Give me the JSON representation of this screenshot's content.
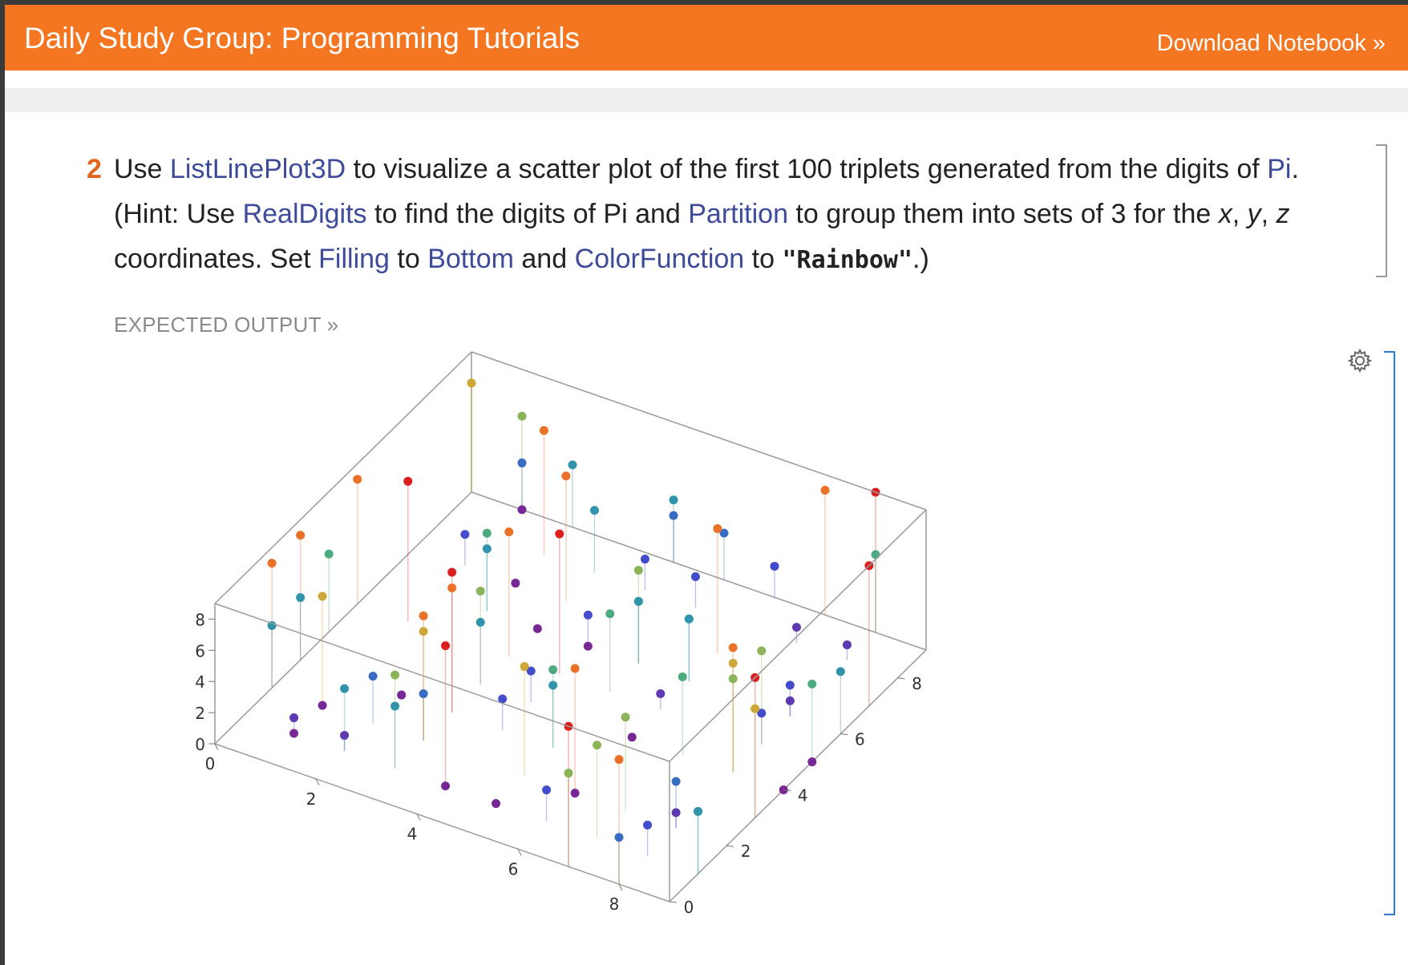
{
  "header": {
    "title": "Daily Study Group: Programming Tutorials",
    "download_label": "Download Notebook »"
  },
  "exercise": {
    "number": "2",
    "parts": {
      "p1": "Use ",
      "f1": "ListLinePlot3D",
      "p2": " to visualize a scatter plot of the first 100 triplets generated from the digits of ",
      "f2": "Pi",
      "p3": ". (Hint: Use ",
      "f3": "RealDigits",
      "p4": " to find the digits of Pi and ",
      "f4": "Partition",
      "p5": " to group them into sets of 3 for the ",
      "v1": "x",
      "p6": ", ",
      "v2": "y",
      "p7": ", ",
      "v3": "z",
      "p8": " coordinates. Set ",
      "f5": "Filling",
      "p9": " to ",
      "f6": "Bottom",
      "p10": " and ",
      "f7": "ColorFunction",
      "p11": " to ",
      "c1": "\"Rainbow\"",
      "p12": ".)"
    }
  },
  "expected_output_label": "EXPECTED OUTPUT »",
  "icons": {
    "settings": "gear-icon"
  },
  "colors": {
    "accent": "#f47621",
    "function_link": "#3d4b9a",
    "number": "#e0661e"
  },
  "chart_data": {
    "type": "scatter",
    "subtype": "3d-stem",
    "filling": "Bottom",
    "color_function": "Rainbow",
    "x_ticks": [
      "0",
      "2",
      "4",
      "6",
      "8"
    ],
    "y_ticks": [
      "0",
      "2",
      "4",
      "6",
      "8"
    ],
    "z_ticks": [
      "0",
      "2",
      "4",
      "6",
      "8"
    ],
    "xlim": [
      0,
      9
    ],
    "ylim": [
      0,
      9
    ],
    "zlim": [
      0,
      9
    ],
    "points": [
      [
        3,
        1,
        4
      ],
      [
        1,
        5,
        9
      ],
      [
        2,
        6,
        5
      ],
      [
        3,
        5,
        8
      ],
      [
        9,
        7,
        9
      ],
      [
        3,
        2,
        3
      ],
      [
        8,
        4,
        6
      ],
      [
        2,
        6,
        4
      ],
      [
        3,
        3,
        8
      ],
      [
        3,
        2,
        7
      ],
      [
        9,
        5,
        0
      ],
      [
        2,
        8,
        8
      ],
      [
        4,
        1,
        9
      ],
      [
        7,
        1,
        6
      ],
      [
        9,
        3,
        9
      ],
      [
        9,
        3,
        7
      ],
      [
        5,
        1,
        0
      ],
      [
        5,
        8,
        2
      ],
      [
        0,
        9,
        7
      ],
      [
        4,
        9,
        4
      ],
      [
        4,
        5,
        9
      ],
      [
        2,
        3,
        0
      ],
      [
        7,
        8,
        1
      ],
      [
        6,
        4,
        0
      ],
      [
        6,
        2,
        8
      ],
      [
        6,
        2,
        0
      ],
      [
        8,
        9,
        9
      ],
      [
        8,
        6,
        2
      ],
      [
        8,
        0,
        3
      ],
      [
        4,
        8,
        2
      ],
      [
        5,
        3,
        4
      ],
      [
        2,
        1,
        1
      ],
      [
        7,
        0,
        6
      ],
      [
        7,
        9,
        8
      ],
      [
        2,
        1,
        4
      ],
      [
        8,
        0,
        8
      ],
      [
        6,
        5,
        1
      ],
      [
        3,
        2,
        8
      ],
      [
        2,
        3,
        0
      ],
      [
        6,
        6,
        4
      ],
      [
        7,
        0,
        9
      ],
      [
        3,
        8,
        4
      ],
      [
        4,
        6,
        0
      ],
      [
        9,
        5,
        5
      ],
      [
        0,
        5,
        8
      ],
      [
        2,
        2,
        3
      ],
      [
        1,
        7,
        2
      ],
      [
        5,
        3,
        5
      ],
      [
        9,
        4,
        0
      ],
      [
        8,
        1,
        2
      ],
      [
        8,
        4,
        8
      ],
      [
        1,
        1,
        1
      ],
      [
        7,
        4,
        5
      ],
      [
        0,
        2,
        8
      ],
      [
        4,
        1,
        0
      ],
      [
        2,
        7,
        0
      ],
      [
        1,
        9,
        3
      ],
      [
        8,
        5,
        2
      ],
      [
        1,
        1,
        0
      ],
      [
        5,
        5,
        5
      ],
      [
        9,
        6,
        4
      ],
      [
        4,
        6,
        2
      ],
      [
        2,
        9,
        4
      ],
      [
        8,
        9,
        5
      ],
      [
        4,
        9,
        3
      ],
      [
        0,
        3,
        8
      ],
      [
        1,
        9,
        6
      ],
      [
        4,
        4,
        2
      ],
      [
        8,
        8,
        1
      ],
      [
        0,
        9,
        7
      ],
      [
        5,
        6,
        6
      ],
      [
        5,
        9,
        3
      ],
      [
        3,
        4,
        4
      ],
      [
        6,
        1,
        2
      ],
      [
        8,
        4,
        7
      ],
      [
        5,
        6,
        4
      ],
      [
        8,
        2,
        3
      ],
      [
        3,
        7,
        8
      ],
      [
        6,
        7,
        8
      ],
      [
        3,
        1,
        6
      ],
      [
        5,
        2,
        7
      ],
      [
        1,
        2,
        0
      ],
      [
        1,
        9,
        0
      ],
      [
        9,
        1,
        4
      ],
      [
        5,
        6,
        4
      ],
      [
        8,
        5,
        6
      ],
      [
        6,
        9,
        2
      ],
      [
        3,
        4,
        6
      ],
      [
        0,
        3,
        4
      ],
      [
        8,
        6,
        1
      ],
      [
        0,
        4,
        5
      ],
      [
        4,
        3,
        2
      ],
      [
        6,
        6,
        4
      ],
      [
        8,
        2,
        1
      ],
      [
        3,
        3,
        9
      ],
      [
        3,
        6,
        0
      ],
      [
        7,
        2,
        6
      ],
      [
        0,
        2,
        4
      ],
      [
        9,
        1,
        4
      ],
      [
        1,
        2,
        7
      ]
    ]
  }
}
